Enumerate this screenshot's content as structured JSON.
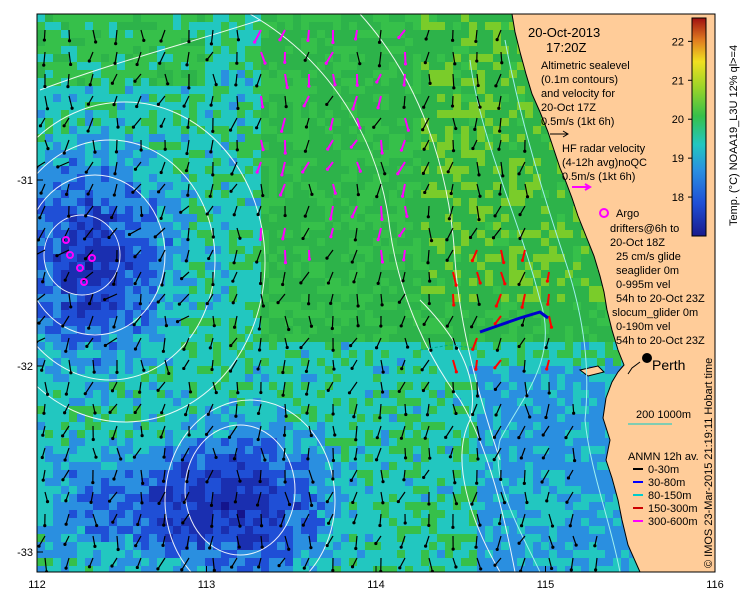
{
  "header": {
    "date": "20-Oct-2013",
    "time": "17:20Z"
  },
  "legend": {
    "altimetry": [
      "Altimetric sealevel",
      "(0.1m contours)",
      "and velocity for",
      "20-Oct 17Z",
      "0.5m/s (1kt 6h)"
    ],
    "hf_radar": [
      "HF radar velocity",
      "(4-12h avg)noQC",
      "0.5m/s (1kt 6h)"
    ],
    "argo": "Argo",
    "drifters": [
      "drifters@6h to",
      "20-Oct 18Z"
    ],
    "glide": "25 cm/s glide",
    "seaglider": [
      "seaglider 0m",
      "0-995m vel",
      "54h to 20-Oct 23Z"
    ],
    "slocum": [
      "slocum_glider 0m",
      "0-190m vel",
      "54h to 20-Oct 23Z"
    ],
    "isobaths": "200  1000m",
    "anmn": {
      "title": "ANMN 12h av.",
      "items": [
        {
          "label": "0-30m",
          "color": "#000000"
        },
        {
          "label": "30-80m",
          "color": "#0000ff"
        },
        {
          "label": "80-150m",
          "color": "#00cccc"
        },
        {
          "label": "150-300m",
          "color": "#cc0000"
        },
        {
          "label": "300-600m",
          "color": "#ff00ff"
        }
      ]
    }
  },
  "city": "Perth",
  "colorbar": {
    "label": "Temp. (°C) NOAA19_L3U 12% ql>=4",
    "ticks": [
      "22",
      "21",
      "20",
      "19",
      "18"
    ],
    "range": [
      17,
      22.6
    ]
  },
  "axes": {
    "x_ticks": [
      "112",
      "113",
      "114",
      "115",
      "116"
    ],
    "y_ticks": [
      "-31",
      "-32",
      "-33"
    ]
  },
  "credit": "© IMOS 23-Mar-2015 21:19:11 Hobart time",
  "colors": {
    "land": "#ffcc99",
    "deep_blue": "#14148c",
    "argo": "#ff00ff",
    "slocum": "#ff0000",
    "seaglider": "#ff00ff"
  }
}
